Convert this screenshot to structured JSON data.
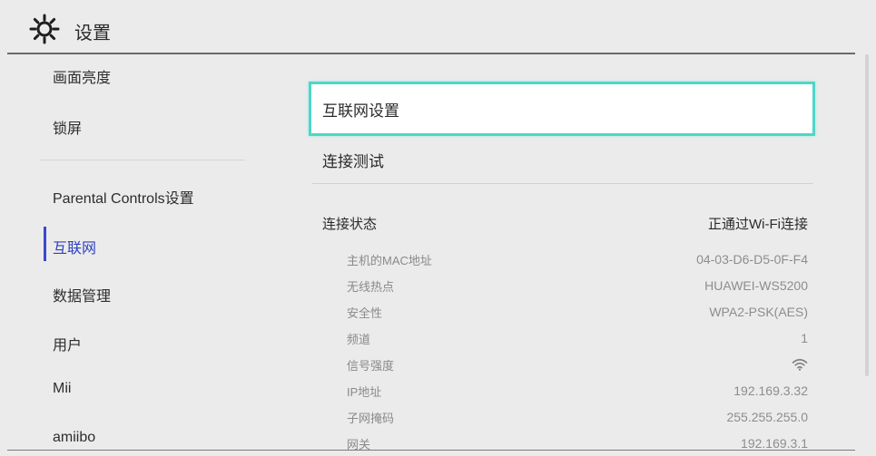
{
  "header": {
    "title": "设置",
    "icon": "gear-icon"
  },
  "sidebar": {
    "items": [
      {
        "label": "画面亮度"
      },
      {
        "label": "锁屏"
      },
      {
        "label": "Parental Controls设置"
      },
      {
        "label": "互联网"
      },
      {
        "label": "数据管理"
      },
      {
        "label": "用户"
      },
      {
        "label": "Mii"
      },
      {
        "label": "amiibo"
      }
    ],
    "active_index": 3
  },
  "main": {
    "menu": [
      {
        "label": "互联网设置"
      },
      {
        "label": "连接测试"
      }
    ],
    "status": {
      "label": "连接状态",
      "value": "正通过Wi-Fi连接"
    },
    "info": [
      {
        "label": "主机的MAC地址",
        "value": "04-03-D6-D5-0F-F4"
      },
      {
        "label": "无线热点",
        "value": "HUAWEI-WS5200"
      },
      {
        "label": "安全性",
        "value": "WPA2-PSK(AES)"
      },
      {
        "label": "频道",
        "value": "1"
      },
      {
        "label": "信号强度",
        "value": "",
        "icon": "wifi-signal-icon"
      },
      {
        "label": "IP地址",
        "value": "192.169.3.32"
      },
      {
        "label": "子网掩码",
        "value": "255.255.255.0"
      },
      {
        "label": "网关",
        "value": "192.169.3.1"
      }
    ]
  },
  "colors": {
    "accent": "#3a49c9",
    "selection_border": "#4fd6c8",
    "background": "#ebebeb"
  }
}
